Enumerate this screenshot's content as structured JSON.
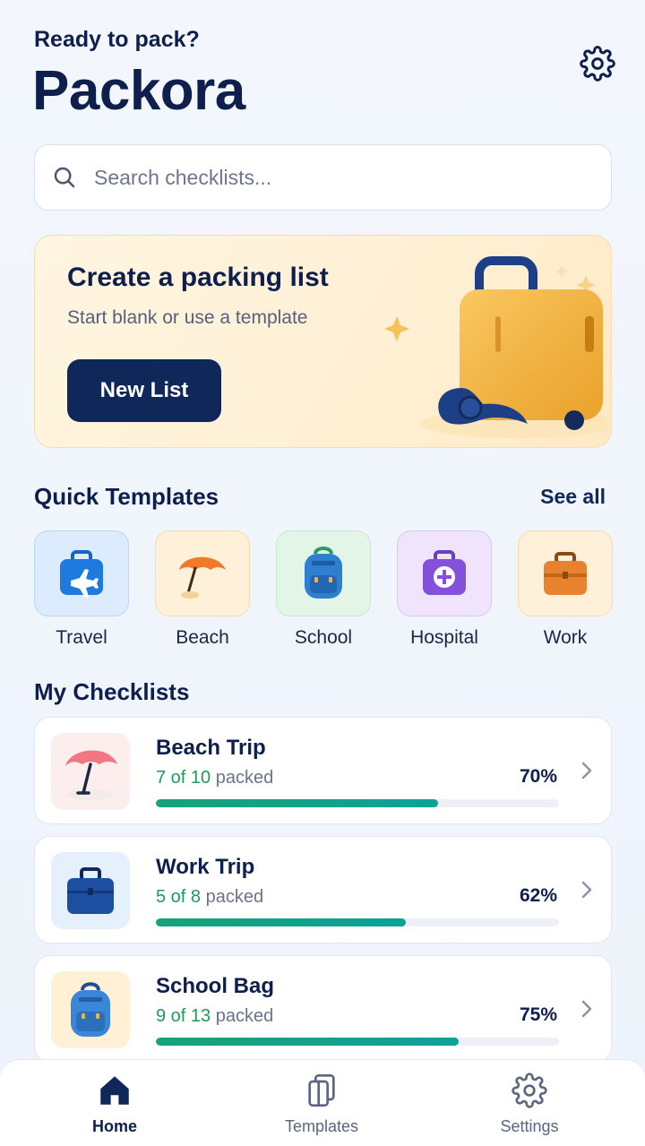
{
  "header": {
    "greeting": "Ready to pack?",
    "title": "Packora",
    "settings_icon": "gear-icon"
  },
  "search": {
    "placeholder": "Search checklists...",
    "value": ""
  },
  "hero": {
    "title": "Create a packing list",
    "subtitle": "Start blank or use a template",
    "button_label": "New List",
    "illustration": "suitcase-illustration"
  },
  "quick_templates": {
    "title": "Quick Templates",
    "see_all_label": "See all",
    "items": [
      {
        "label": "Travel",
        "icon": "airplane-suitcase-icon",
        "bg": "#dcebfd",
        "border": "#b9d7fa"
      },
      {
        "label": "Beach",
        "icon": "beach-umbrella-icon",
        "bg": "#fff0da",
        "border": "#f7dcae"
      },
      {
        "label": "School",
        "icon": "backpack-icon",
        "bg": "#e3f5e6",
        "border": "#c6e9cc"
      },
      {
        "label": "Hospital",
        "icon": "medical-kit-icon",
        "bg": "#efe4fb",
        "border": "#dac7f6"
      },
      {
        "label": "Work",
        "icon": "briefcase-icon",
        "bg": "#fff0da",
        "border": "#f7dcae"
      }
    ]
  },
  "checklists": {
    "title": "My Checklists",
    "items": [
      {
        "name": "Beach Trip",
        "count": "7 of 10",
        "suffix": "packed",
        "percent_label": "70%",
        "progress": 0.7,
        "icon": "beach-umbrella-icon",
        "thumb_bg": "#fdeeee"
      },
      {
        "name": "Work Trip",
        "count": "5 of 8",
        "suffix": "packed",
        "percent_label": "62%",
        "progress": 0.62,
        "icon": "briefcase-icon",
        "thumb_bg": "#e5f0fd"
      },
      {
        "name": "School Bag",
        "count": "9 of 13",
        "suffix": "packed",
        "percent_label": "75%",
        "progress": 0.75,
        "icon": "backpack-icon",
        "thumb_bg": "#fff0d6"
      }
    ]
  },
  "bottom_nav": {
    "items": [
      {
        "label": "Home",
        "icon": "home-icon",
        "active": true
      },
      {
        "label": "Templates",
        "icon": "templates-icon",
        "active": false
      },
      {
        "label": "Settings",
        "icon": "gear-icon",
        "active": false
      }
    ]
  },
  "colors": {
    "navy": "#0f1f4d",
    "button": "#10275a",
    "progress": "#17a278",
    "count_green": "#1f9a5b"
  }
}
